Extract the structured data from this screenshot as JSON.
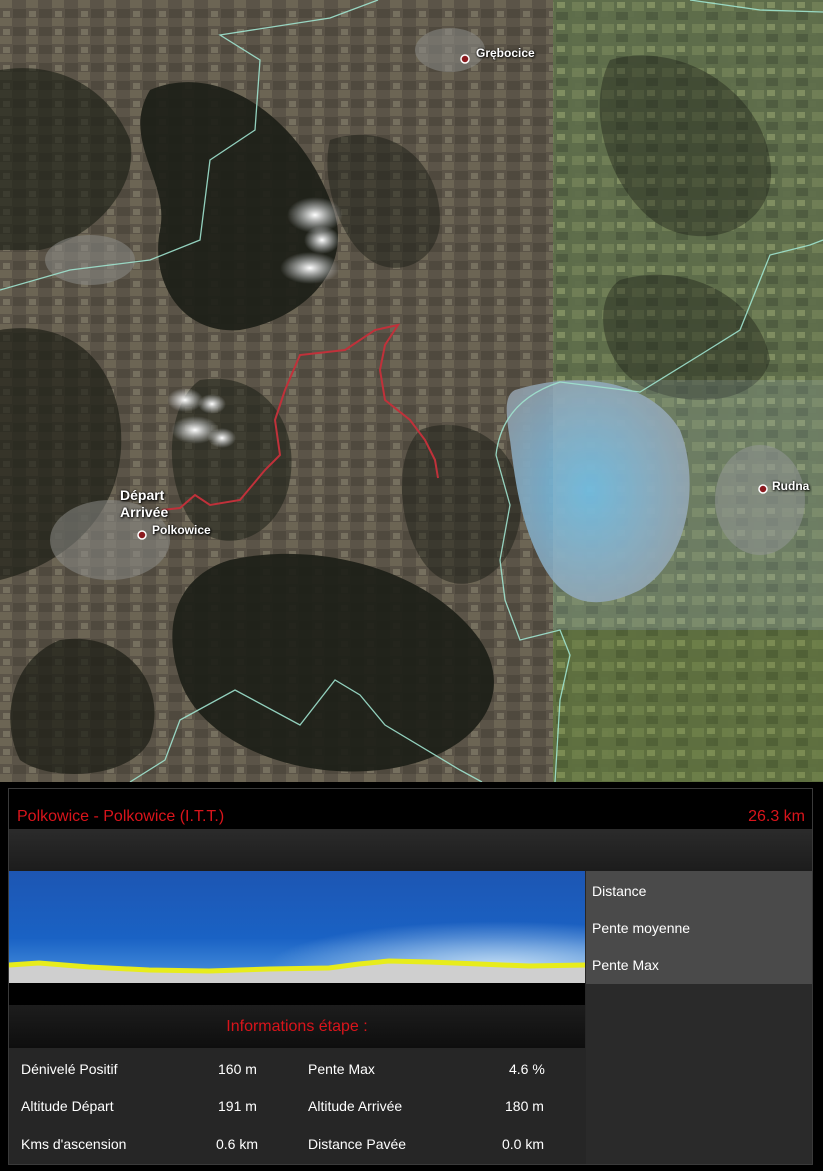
{
  "map": {
    "towns": {
      "grebocice": "Grębocice",
      "rudna": "Rudna",
      "polkowice": "Polkowice"
    },
    "start_label": {
      "line1": "Départ",
      "line2": "Arrivée"
    },
    "route_color": "#c0313a",
    "border_color": "#9fe3cf"
  },
  "panel": {
    "stage_title": "Polkowice - Polkowice (I.T.T.)",
    "stage_distance": "26.3 km",
    "legend": [
      "Distance",
      "Pente moyenne",
      "Pente Max"
    ],
    "info_header": "Informations étape :",
    "rows": [
      {
        "label1": "Dénivelé Positif",
        "value1": "160 m",
        "label2": "Pente Max",
        "value2": "4.6 %"
      },
      {
        "label1": "Altitude Départ",
        "value1": "191 m",
        "label2": "Altitude Arrivée",
        "value2": "180 m"
      },
      {
        "label1": "Kms d'ascension",
        "value1": "0.6 km",
        "label2": "Distance Pavée",
        "value2": "0.0 km"
      }
    ],
    "accent_color": "#d9141b",
    "profile_line_color": "#e7ec1c"
  }
}
